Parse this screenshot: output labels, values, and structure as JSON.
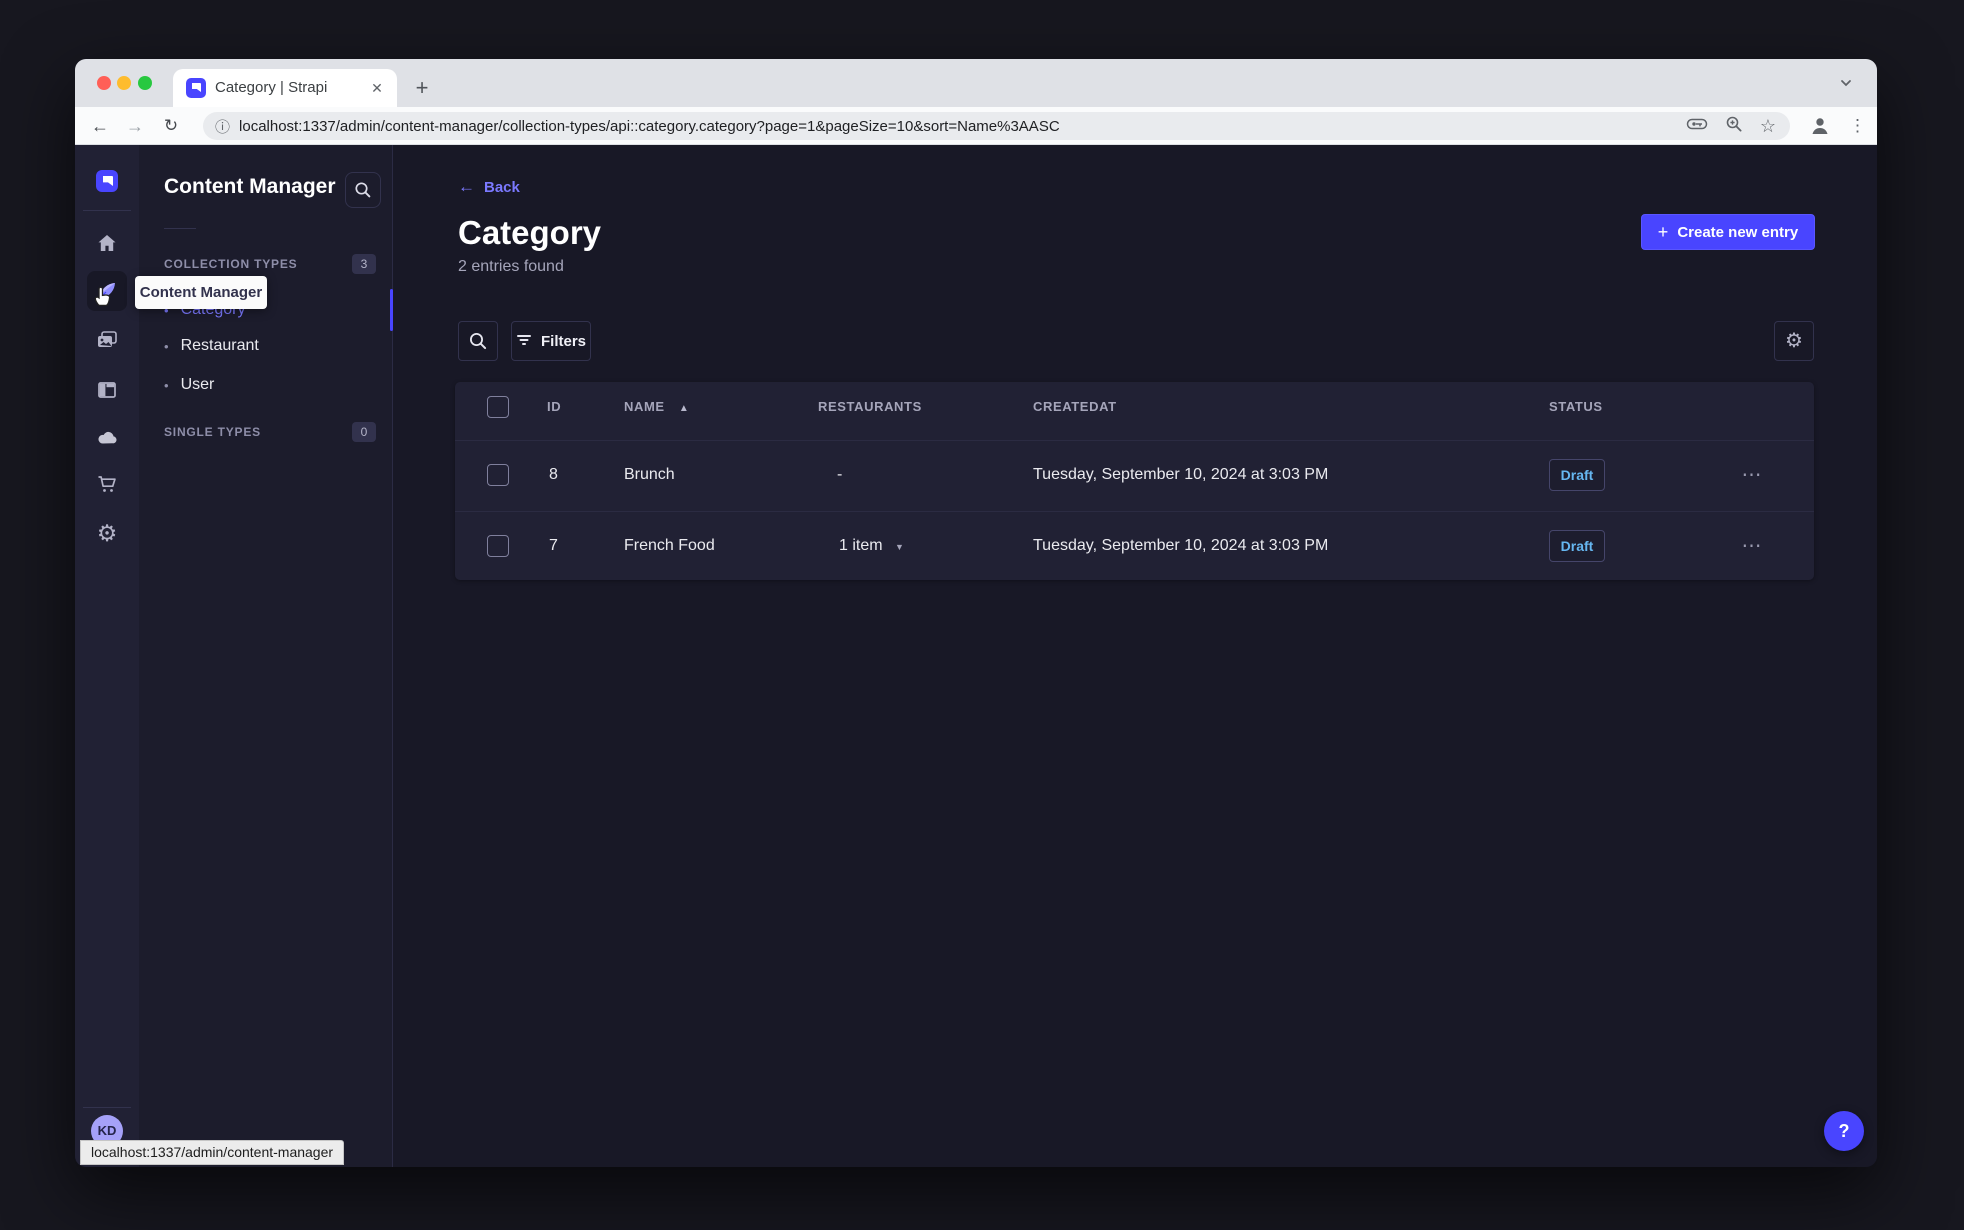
{
  "browser": {
    "tab_title": "Category | Strapi",
    "url": "localhost:1337/admin/content-manager/collection-types/api::category.category?page=1&pageSize=10&sort=Name%3AASC",
    "status_tooltip": "localhost:1337/admin/content-manager"
  },
  "navbar": {
    "icons": [
      "strapi-logo",
      "home",
      "content-manager",
      "media-library",
      "content-type-builder",
      "cloud",
      "marketplace",
      "settings"
    ],
    "tooltip": "Content Manager",
    "user_initials": "KD"
  },
  "subnav": {
    "title": "Content Manager",
    "sections": [
      {
        "label": "COLLECTION TYPES",
        "count": "3"
      },
      {
        "label": "SINGLE TYPES",
        "count": "0"
      }
    ],
    "items": [
      {
        "label": "Category",
        "active": true
      },
      {
        "label": "Restaurant",
        "active": false
      },
      {
        "label": "User",
        "active": false
      }
    ]
  },
  "main": {
    "back_label": "Back",
    "title": "Category",
    "subtitle": "2 entries found",
    "create_button": "Create new entry",
    "filters_button": "Filters"
  },
  "table": {
    "headers": [
      "ID",
      "NAME",
      "RESTAURANTS",
      "CREATEDAT",
      "STATUS"
    ],
    "rows": [
      {
        "id": "8",
        "name": "Brunch",
        "restaurants": "-",
        "created_at": "Tuesday, September 10, 2024 at 3:03 PM",
        "status": "Draft"
      },
      {
        "id": "7",
        "name": "French Food",
        "restaurants": "1 item",
        "created_at": "Tuesday, September 10, 2024 at 3:03 PM",
        "status": "Draft"
      }
    ]
  },
  "icons": {
    "close": "✕",
    "plus": "+",
    "back_arrow": "←",
    "forward_arrow": "→",
    "reload": "↻",
    "info": "ⓘ",
    "star": "☆",
    "kebab_vertical": "⋮",
    "kebab_horizontal": "⋯",
    "sort_asc": "▲",
    "caret_down": "▼",
    "bullet": "•",
    "question": "?",
    "gear": "⚙"
  },
  "colors": {
    "primary": "#4945ff",
    "accent_text": "#7b79ff",
    "draft_text": "#66b7f1"
  }
}
